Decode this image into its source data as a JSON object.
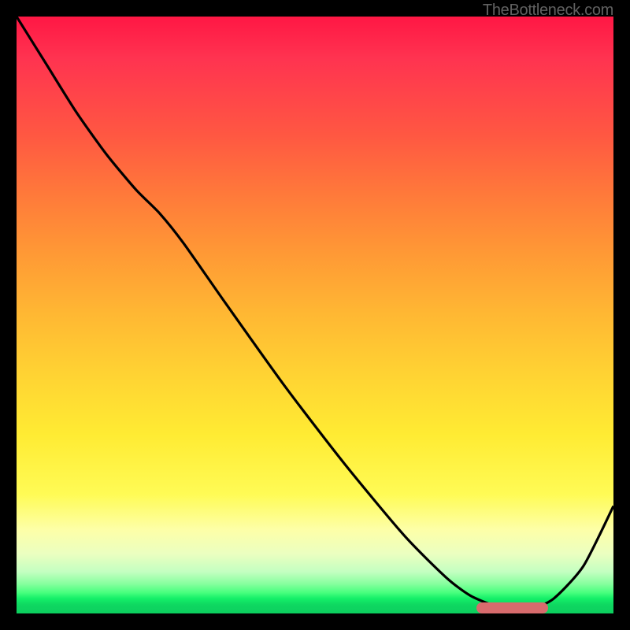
{
  "attribution": "TheBottleneck.com",
  "colors": {
    "curve": "#000000",
    "marker": "#d86b6d"
  },
  "chart_data": {
    "type": "line",
    "title": "",
    "xlabel": "",
    "ylabel": "",
    "xlim": [
      0,
      100
    ],
    "ylim": [
      0,
      100
    ],
    "x": [
      0,
      5,
      10,
      15,
      20,
      24,
      28,
      35,
      45,
      55,
      65,
      72,
      76,
      80,
      83,
      86,
      90,
      95,
      100
    ],
    "values": [
      100,
      92,
      84,
      77,
      71,
      67,
      62,
      52,
      38,
      25,
      13,
      6,
      3,
      1.3,
      0.6,
      0.6,
      2.5,
      8,
      18
    ],
    "marker": {
      "x_start": 77,
      "x_end": 89,
      "y": 0.9
    },
    "grid": false
  }
}
